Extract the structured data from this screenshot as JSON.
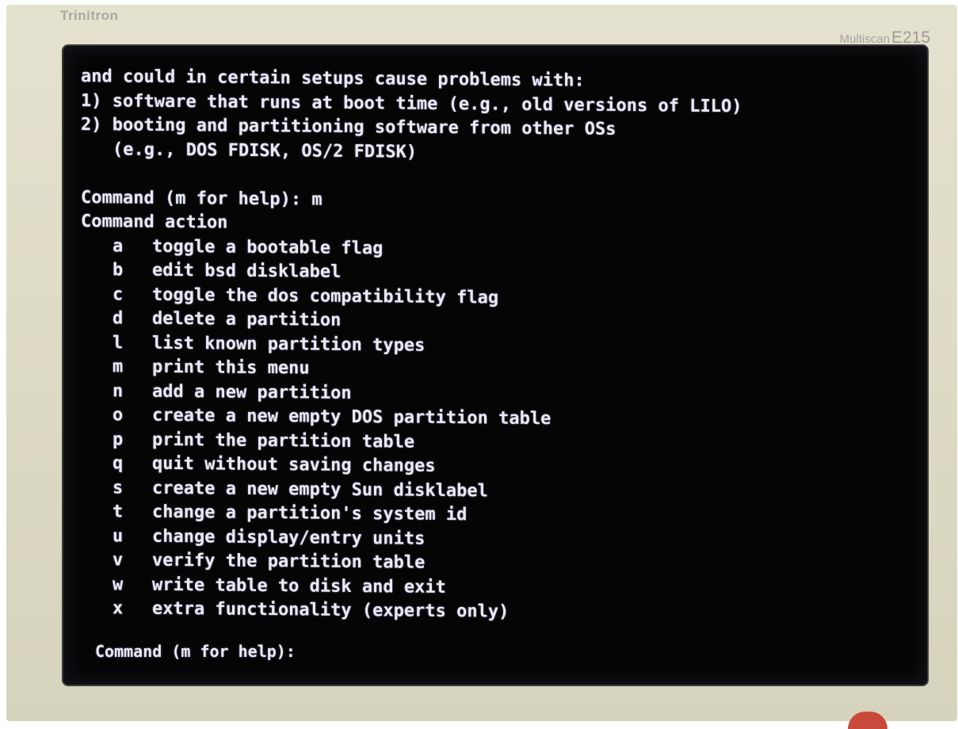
{
  "monitor": {
    "brand": "Trinitron",
    "model_prefix": "Multiscan",
    "model": "E215"
  },
  "terminal": {
    "intro_lines": [
      "and could in certain setups cause problems with:",
      "1) software that runs at boot time (e.g., old versions of LILO)",
      "2) booting and partitioning software from other OSs",
      "(e.g., DOS FDISK, OS/2 FDISK)"
    ],
    "prompt_with_input": "Command (m for help): m",
    "menu_header": "Command action",
    "menu": [
      {
        "key": "a",
        "desc": "toggle a bootable flag"
      },
      {
        "key": "b",
        "desc": "edit bsd disklabel"
      },
      {
        "key": "c",
        "desc": "toggle the dos compatibility flag"
      },
      {
        "key": "d",
        "desc": "delete a partition"
      },
      {
        "key": "l",
        "desc": "list known partition types"
      },
      {
        "key": "m",
        "desc": "print this menu"
      },
      {
        "key": "n",
        "desc": "add a new partition"
      },
      {
        "key": "o",
        "desc": "create a new empty DOS partition table"
      },
      {
        "key": "p",
        "desc": "print the partition table"
      },
      {
        "key": "q",
        "desc": "quit without saving changes"
      },
      {
        "key": "s",
        "desc": "create a new empty Sun disklabel"
      },
      {
        "key": "t",
        "desc": "change a partition's system id"
      },
      {
        "key": "u",
        "desc": "change display/entry units"
      },
      {
        "key": "v",
        "desc": "verify the partition table"
      },
      {
        "key": "w",
        "desc": "write table to disk and exit"
      },
      {
        "key": "x",
        "desc": "extra functionality (experts only)"
      }
    ],
    "final_prompt": "Command (m for help):"
  }
}
